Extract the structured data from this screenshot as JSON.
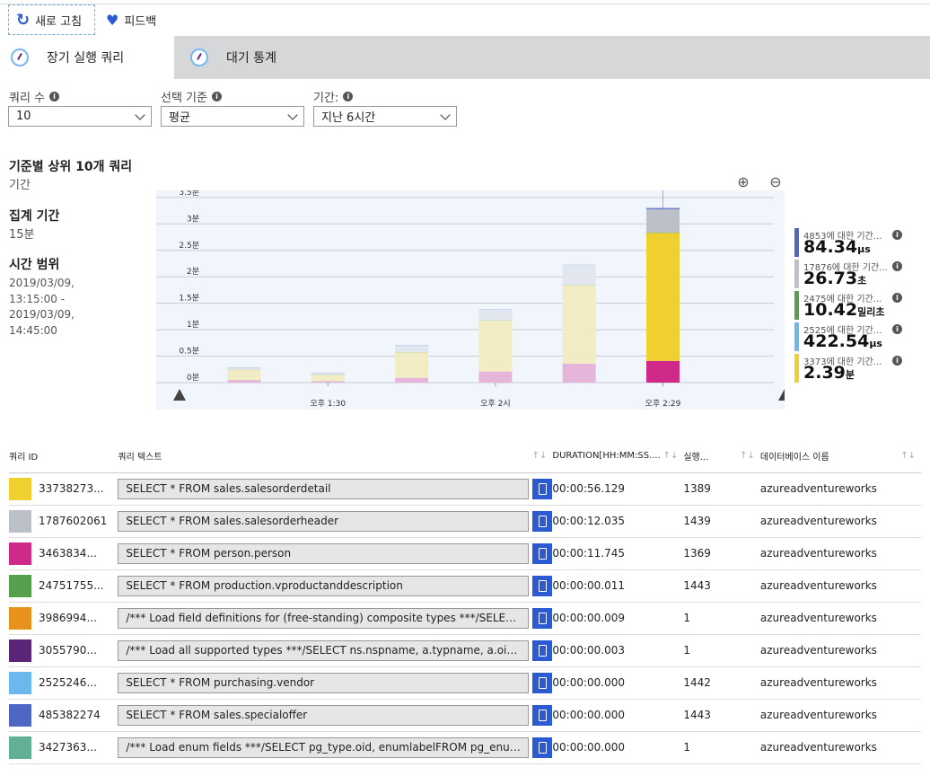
{
  "toolbar": {
    "refresh": "새로 고침",
    "feedback": "피드백"
  },
  "tabs": [
    {
      "label": "장기 실행 쿼리",
      "active": true
    },
    {
      "label": "대기 통계",
      "active": false
    }
  ],
  "filters": [
    {
      "label": "쿼리 수",
      "value": "10"
    },
    {
      "label": "선택 기준",
      "value": "평균"
    },
    {
      "label": "기간:",
      "value": "지난 6시간"
    }
  ],
  "summary": {
    "title": "기준별 상위 10개 쿼리",
    "criterion": "기간",
    "agg_label": "집계 기간",
    "agg_value": "15분",
    "range_label": "시간 범위",
    "range_lines": [
      "2019/03/09,",
      "13:15:00 -",
      "2019/03/09,",
      "14:45:00"
    ]
  },
  "chart_data": {
    "type": "bar",
    "stacked": true,
    "x": [
      "13:15",
      "13:30",
      "13:45",
      "14:00",
      "14:15",
      "14:30"
    ],
    "xtick_labels": [
      {
        "at": "13:30",
        "label": "오후 1:30"
      },
      {
        "at": "14:00",
        "label": "오후 2시"
      },
      {
        "at": "14:30",
        "label": "오후 2:29"
      }
    ],
    "ytick_labels": [
      "0분",
      "0.5분",
      "1분",
      "1.5분",
      "2분",
      "2.5분",
      "3분",
      "3.5분"
    ],
    "ylim": [
      0,
      3.5
    ],
    "yunit": "분",
    "grid": true,
    "legend": "right",
    "selected_index": 5,
    "series": [
      {
        "id": "3463834",
        "color": "#cf2a8a",
        "faded": "#e6b6da",
        "values": [
          0.05,
          0.03,
          0.09,
          0.21,
          0.36,
          0.41
        ]
      },
      {
        "id": "3373",
        "color": "#f0d030",
        "faded": "#f2ecc4",
        "values": [
          0.19,
          0.11,
          0.48,
          0.96,
          1.48,
          2.42
        ]
      },
      {
        "id": "2475",
        "color": "#55a04c",
        "faded": "#b9d6b4",
        "values": [
          0.01,
          0.01,
          0.01,
          0.01,
          0.01,
          0.01
        ]
      },
      {
        "id": "17876",
        "color": "#bcc0c8",
        "faded": "#e2e6ee",
        "values": [
          0.03,
          0.03,
          0.12,
          0.2,
          0.37,
          0.44
        ]
      },
      {
        "id": "4853",
        "color": "#4f67c4",
        "faded": "#b8c4e8",
        "values": [
          0.01,
          0.01,
          0.01,
          0.01,
          0.01,
          0.02
        ]
      }
    ]
  },
  "legend": [
    {
      "label": "4853에 대한 기간...",
      "value": "84.34",
      "unit": "μs",
      "color": "#4f67c4"
    },
    {
      "label": "17876에 대한 기간...",
      "value": "26.73",
      "unit": "초",
      "color": "#bcc0c8"
    },
    {
      "label": "2475에 대한 기간...",
      "value": "10.42",
      "unit": "밀리초",
      "color": "#55a04c"
    },
    {
      "label": "2525에 대한 기간...",
      "value": "422.54",
      "unit": "μs",
      "color": "#6ab8ee"
    },
    {
      "label": "3373에 대한 기간...",
      "value": "2.39",
      "unit": "분",
      "color": "#f0d030"
    }
  ],
  "table": {
    "headers": [
      "쿼리 ID",
      "쿼리 텍스트",
      "DURATION[HH:MM:SS....",
      "실행...",
      "데이터베이스 이름"
    ],
    "rows": [
      {
        "color": "#f0d030",
        "id": "33738273...",
        "text": "SELECT * FROM sales.salesorderdetail",
        "duration": "00:00:56.129",
        "exec": "1389",
        "db": "azureadventureworks"
      },
      {
        "color": "#bcc0c8",
        "id": "1787602061",
        "text": "SELECT * FROM sales.salesorderheader",
        "duration": "00:00:12.035",
        "exec": "1439",
        "db": "azureadventureworks"
      },
      {
        "color": "#cf2a8a",
        "id": "3463834...",
        "text": "SELECT * FROM person.person",
        "duration": "00:00:11.745",
        "exec": "1369",
        "db": "azureadventureworks"
      },
      {
        "color": "#55a04c",
        "id": "24751755...",
        "text": "SELECT * FROM production.vproductanddescription",
        "duration": "00:00:00.011",
        "exec": "1443",
        "db": "azureadventureworks"
      },
      {
        "color": "#e8921e",
        "id": "3986994...",
        "text": "/*** Load field definitions for (free-standing) composite types ***/SELECT t...",
        "duration": "00:00:00.009",
        "exec": "1",
        "db": "azureadventureworks"
      },
      {
        "color": "#5b2577",
        "id": "3055790...",
        "text": "/*** Load all supported types ***/SELECT ns.nspname, a.typname, a.oid, a.t...",
        "duration": "00:00:00.003",
        "exec": "1",
        "db": "azureadventureworks"
      },
      {
        "color": "#6ab8ee",
        "id": "2525246...",
        "text": "SELECT * FROM purchasing.vendor",
        "duration": "00:00:00.000",
        "exec": "1442",
        "db": "azureadventureworks"
      },
      {
        "color": "#4f67c4",
        "id": "485382274",
        "text": "SELECT * FROM sales.specialoffer",
        "duration": "00:00:00.000",
        "exec": "1443",
        "db": "azureadventureworks"
      },
      {
        "color": "#62b093",
        "id": "3427363...",
        "text": "/*** Load enum fields ***/SELECT pg_type.oid, enumlabelFROM pg_enumJ...",
        "duration": "00:00:00.000",
        "exec": "1",
        "db": "azureadventureworks"
      }
    ]
  }
}
